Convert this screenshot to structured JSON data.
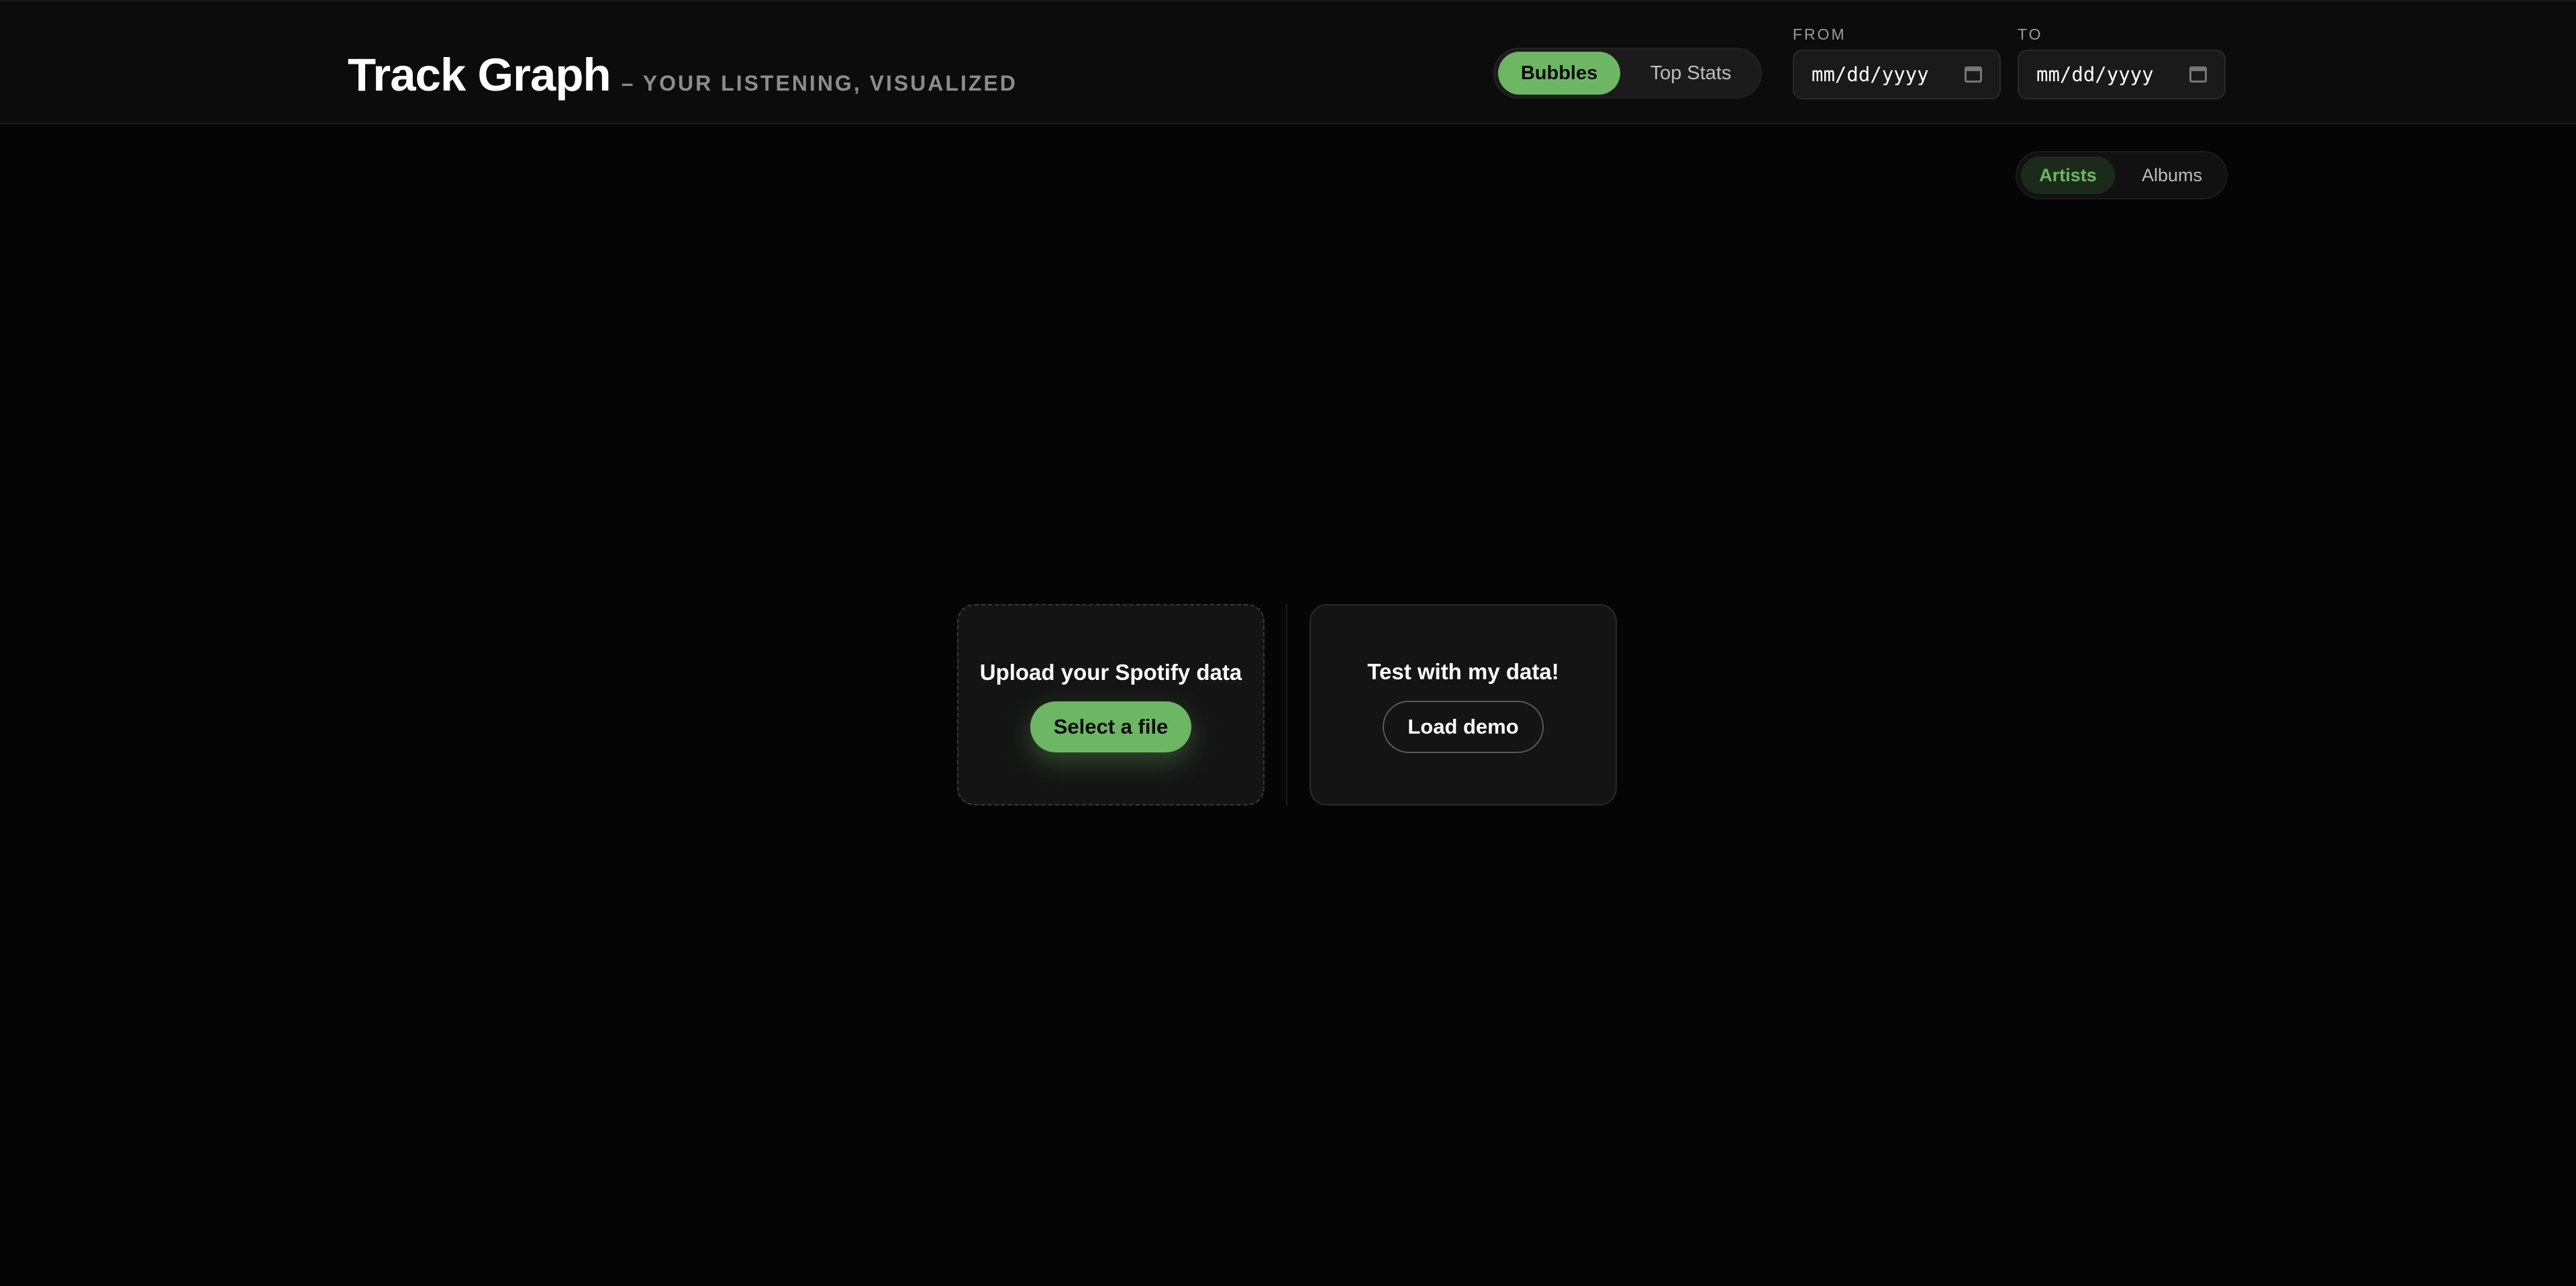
{
  "header": {
    "title": "Track Graph",
    "subtitle": "– YOUR LISTENING, VISUALIZED"
  },
  "view_toggle": {
    "options": [
      {
        "label": "Bubbles",
        "selected": true
      },
      {
        "label": "Top Stats",
        "selected": false
      }
    ]
  },
  "date_range": {
    "from": {
      "label": "FROM",
      "value": "mm/dd/yyyy"
    },
    "to": {
      "label": "TO",
      "value": "mm/dd/yyyy"
    }
  },
  "type_toggle": {
    "options": [
      {
        "label": "Artists",
        "selected": true
      },
      {
        "label": "Albums",
        "selected": false
      }
    ]
  },
  "upload_card": {
    "title": "Upload your Spotify data",
    "button_label": "Select a file"
  },
  "demo_card": {
    "title": "Test with my data!",
    "button_label": "Load demo"
  },
  "colors": {
    "accent": "#6db664",
    "background": "#050505",
    "header_bg": "#0c0c0c",
    "card_bg": "#141414"
  }
}
